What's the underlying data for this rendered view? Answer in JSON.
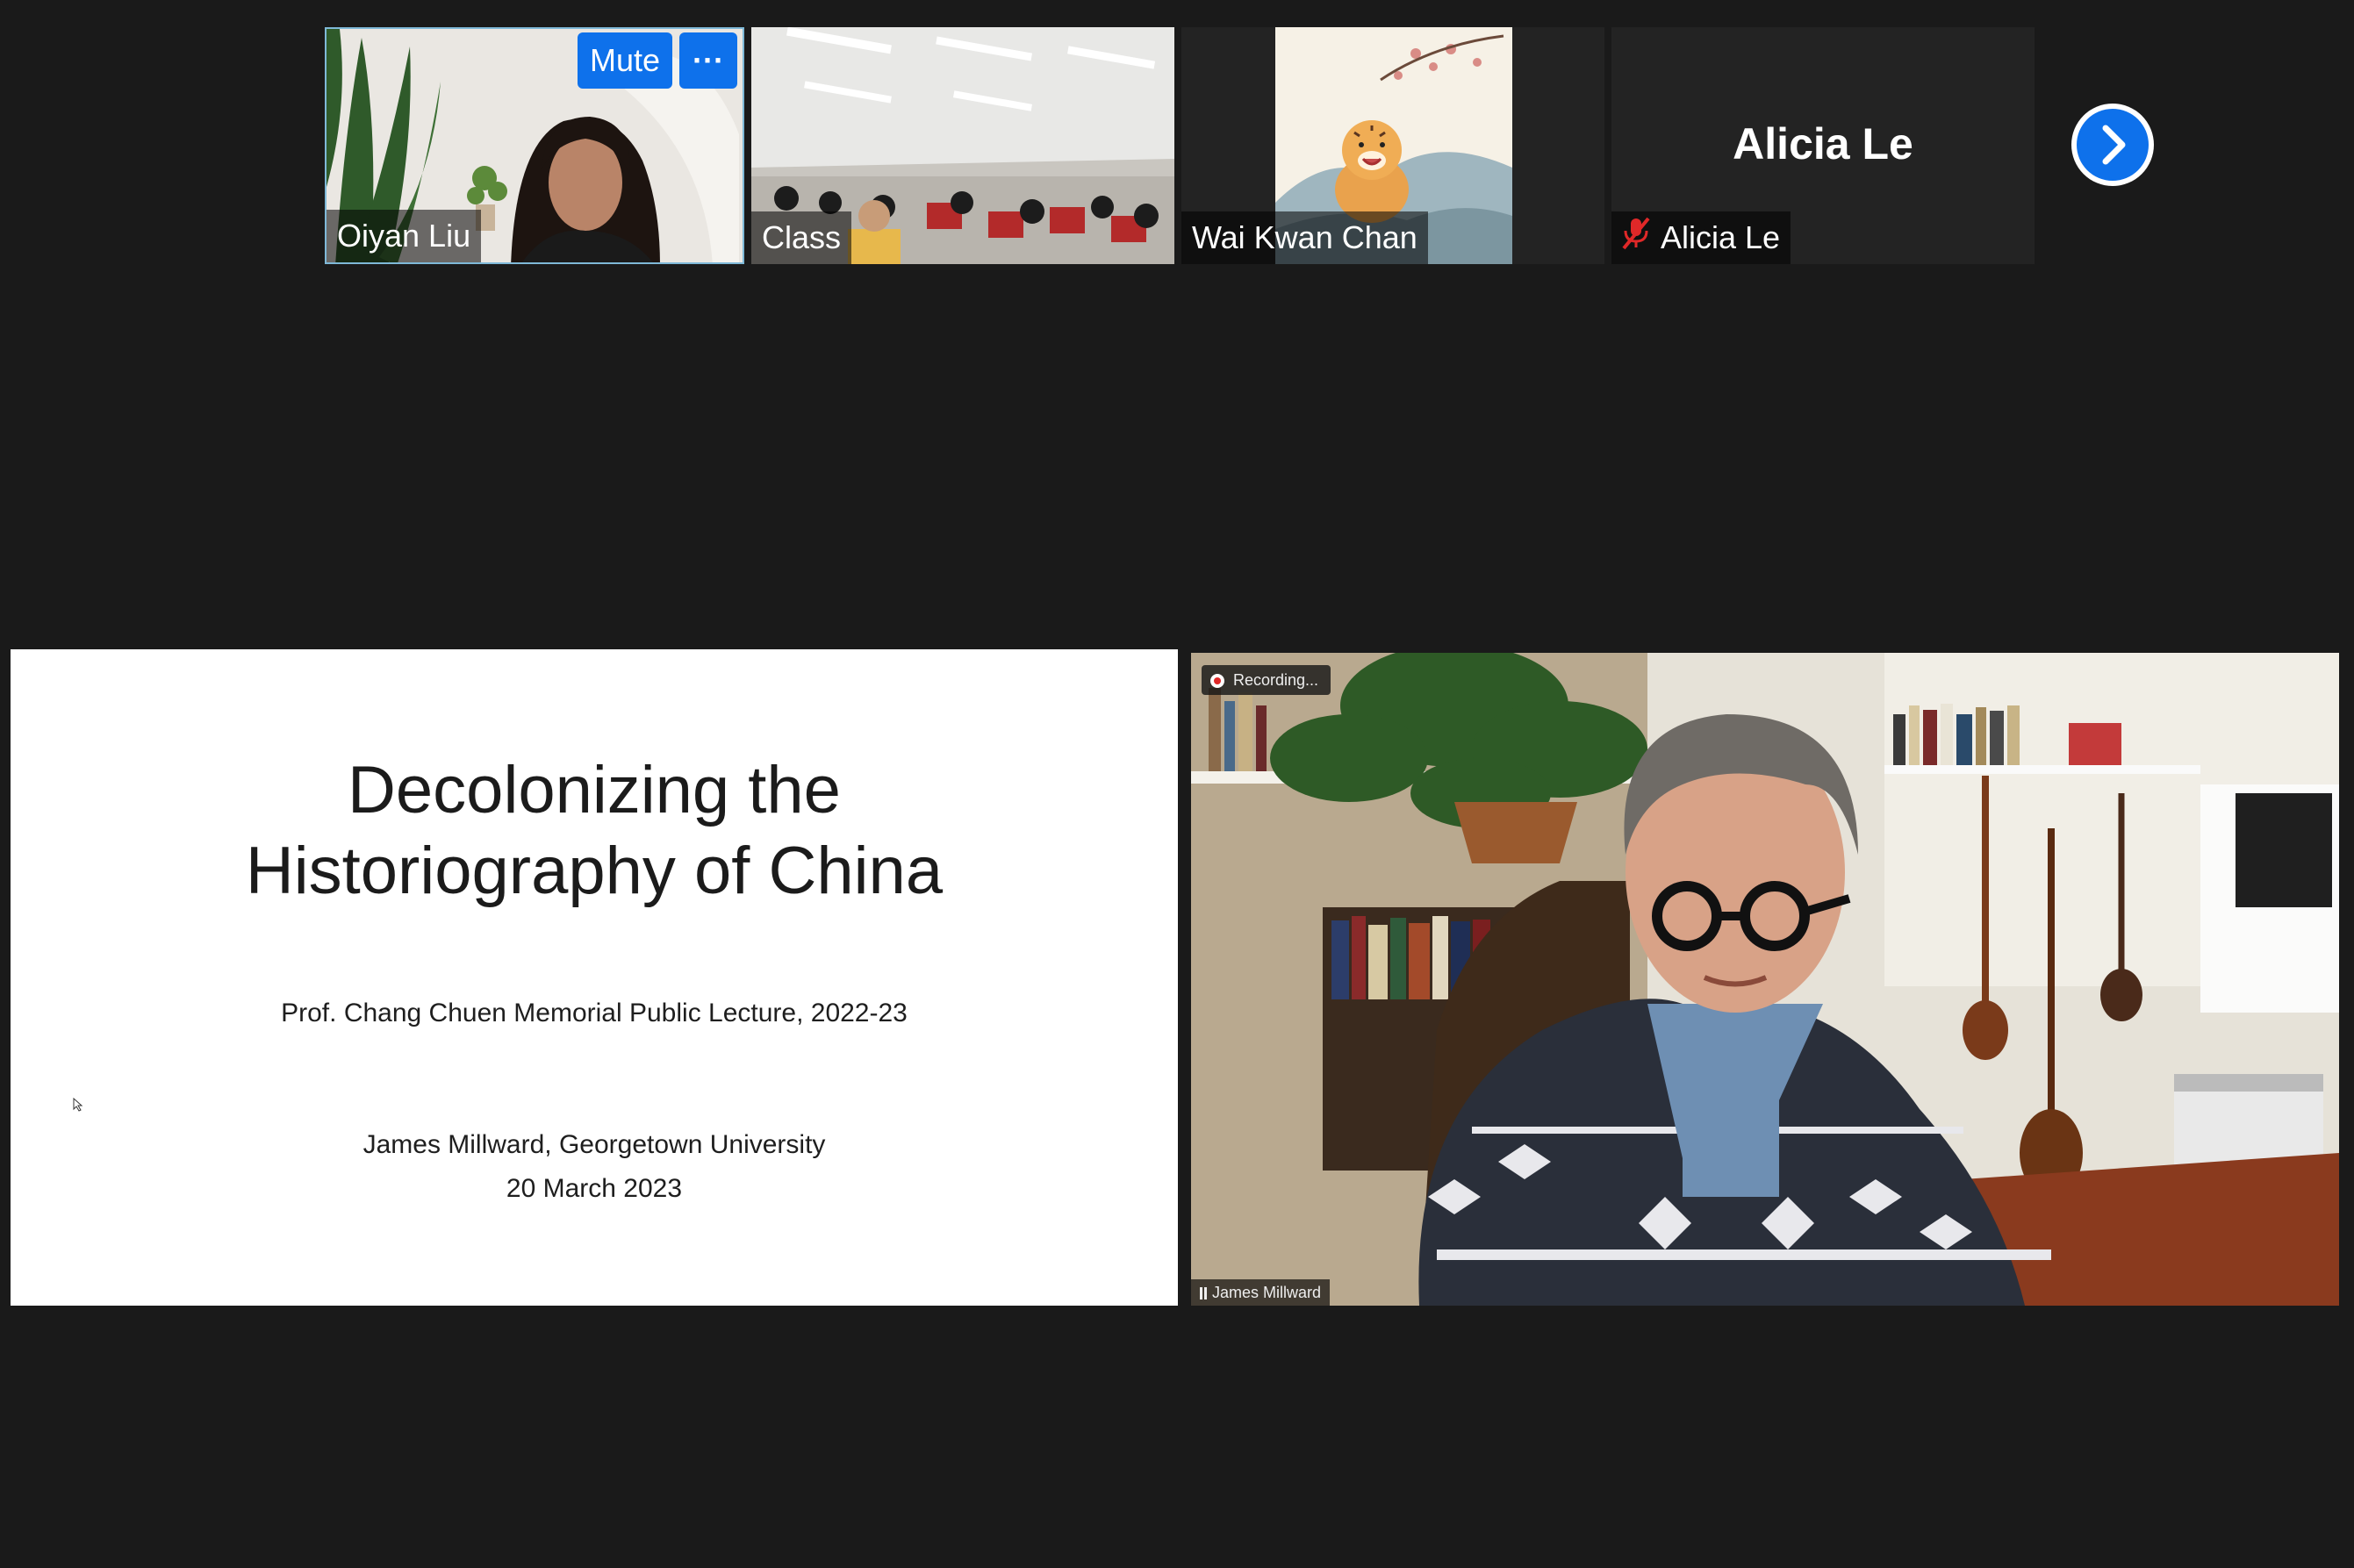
{
  "participants": [
    {
      "name": "Oiyan Liu"
    },
    {
      "name": "Class"
    },
    {
      "name": "Wai Kwan Chan"
    },
    {
      "name": "Alicia Le",
      "display_name": "Alicia Le",
      "muted": true
    }
  ],
  "tile_controls": {
    "mute_label": "Mute",
    "more_label": "···"
  },
  "next_page_icon": "chevron-right-icon",
  "slide": {
    "title_line1": "Decolonizing the",
    "title_line2": "Historiography of China",
    "subtitle": "Prof. Chang Chuen Memorial Public Lecture, 2022-23",
    "author": "James Millward, Georgetown University",
    "date": "20 March 2023"
  },
  "speaker": {
    "name": "James Millward",
    "recording_label": "Recording..."
  },
  "colors": {
    "accent": "#0e71eb",
    "background": "#1a1a1a",
    "muted_mic": "#e02828"
  }
}
